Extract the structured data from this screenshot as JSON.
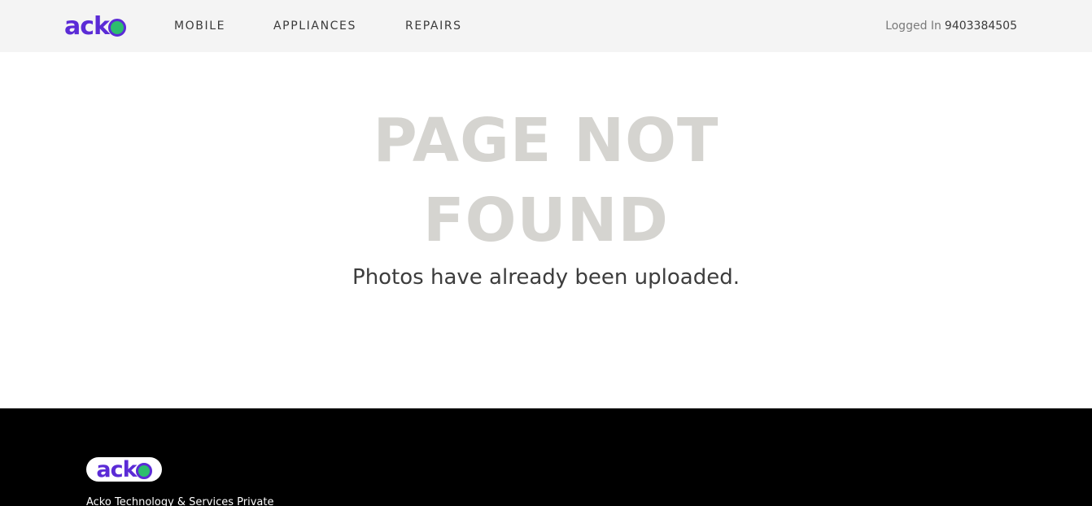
{
  "header": {
    "logo_text": "ack",
    "nav": [
      {
        "label": "MOBILE"
      },
      {
        "label": "APPLIANCES"
      },
      {
        "label": "REPAIRS"
      }
    ],
    "login_label": "Logged In",
    "login_phone": "9403384505"
  },
  "main": {
    "title_line1": "PAGE NOT",
    "title_line2": "FOUND",
    "message": "Photos have already been uploaded."
  },
  "footer": {
    "logo_text": "ack",
    "company_text": "Acko Technology & Services Private"
  },
  "colors": {
    "brand_purple": "#5b2bd6",
    "brand_green": "#2dbd6e",
    "header_bg": "#f4f4f4",
    "footer_bg": "#000000",
    "title_gray": "#d5d4d0"
  }
}
